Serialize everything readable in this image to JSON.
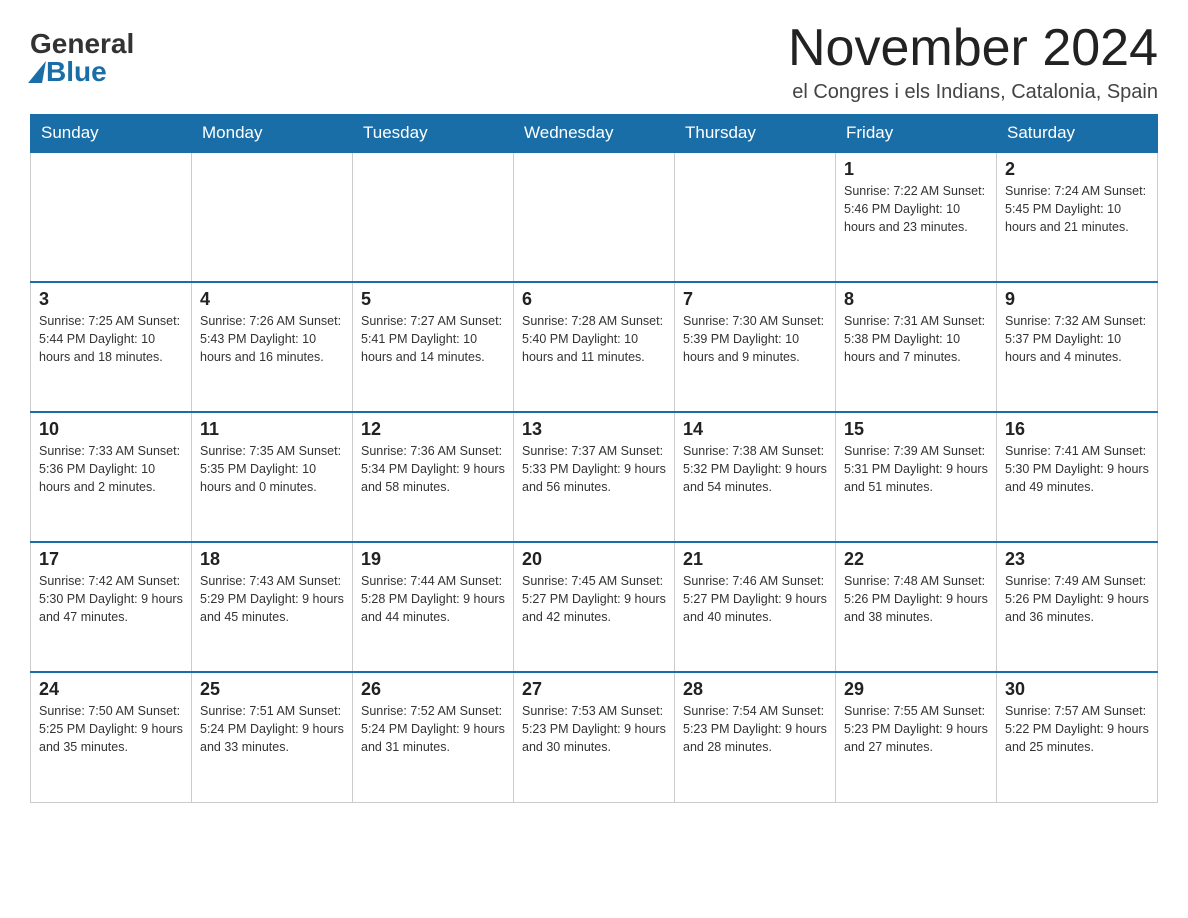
{
  "header": {
    "logo_general": "General",
    "logo_blue": "Blue",
    "month_title": "November 2024",
    "subtitle": "el Congres i els Indians, Catalonia, Spain"
  },
  "days_of_week": [
    "Sunday",
    "Monday",
    "Tuesday",
    "Wednesday",
    "Thursday",
    "Friday",
    "Saturday"
  ],
  "weeks": [
    [
      {
        "day": "",
        "info": ""
      },
      {
        "day": "",
        "info": ""
      },
      {
        "day": "",
        "info": ""
      },
      {
        "day": "",
        "info": ""
      },
      {
        "day": "",
        "info": ""
      },
      {
        "day": "1",
        "info": "Sunrise: 7:22 AM\nSunset: 5:46 PM\nDaylight: 10 hours and 23 minutes."
      },
      {
        "day": "2",
        "info": "Sunrise: 7:24 AM\nSunset: 5:45 PM\nDaylight: 10 hours and 21 minutes."
      }
    ],
    [
      {
        "day": "3",
        "info": "Sunrise: 7:25 AM\nSunset: 5:44 PM\nDaylight: 10 hours and 18 minutes."
      },
      {
        "day": "4",
        "info": "Sunrise: 7:26 AM\nSunset: 5:43 PM\nDaylight: 10 hours and 16 minutes."
      },
      {
        "day": "5",
        "info": "Sunrise: 7:27 AM\nSunset: 5:41 PM\nDaylight: 10 hours and 14 minutes."
      },
      {
        "day": "6",
        "info": "Sunrise: 7:28 AM\nSunset: 5:40 PM\nDaylight: 10 hours and 11 minutes."
      },
      {
        "day": "7",
        "info": "Sunrise: 7:30 AM\nSunset: 5:39 PM\nDaylight: 10 hours and 9 minutes."
      },
      {
        "day": "8",
        "info": "Sunrise: 7:31 AM\nSunset: 5:38 PM\nDaylight: 10 hours and 7 minutes."
      },
      {
        "day": "9",
        "info": "Sunrise: 7:32 AM\nSunset: 5:37 PM\nDaylight: 10 hours and 4 minutes."
      }
    ],
    [
      {
        "day": "10",
        "info": "Sunrise: 7:33 AM\nSunset: 5:36 PM\nDaylight: 10 hours and 2 minutes."
      },
      {
        "day": "11",
        "info": "Sunrise: 7:35 AM\nSunset: 5:35 PM\nDaylight: 10 hours and 0 minutes."
      },
      {
        "day": "12",
        "info": "Sunrise: 7:36 AM\nSunset: 5:34 PM\nDaylight: 9 hours and 58 minutes."
      },
      {
        "day": "13",
        "info": "Sunrise: 7:37 AM\nSunset: 5:33 PM\nDaylight: 9 hours and 56 minutes."
      },
      {
        "day": "14",
        "info": "Sunrise: 7:38 AM\nSunset: 5:32 PM\nDaylight: 9 hours and 54 minutes."
      },
      {
        "day": "15",
        "info": "Sunrise: 7:39 AM\nSunset: 5:31 PM\nDaylight: 9 hours and 51 minutes."
      },
      {
        "day": "16",
        "info": "Sunrise: 7:41 AM\nSunset: 5:30 PM\nDaylight: 9 hours and 49 minutes."
      }
    ],
    [
      {
        "day": "17",
        "info": "Sunrise: 7:42 AM\nSunset: 5:30 PM\nDaylight: 9 hours and 47 minutes."
      },
      {
        "day": "18",
        "info": "Sunrise: 7:43 AM\nSunset: 5:29 PM\nDaylight: 9 hours and 45 minutes."
      },
      {
        "day": "19",
        "info": "Sunrise: 7:44 AM\nSunset: 5:28 PM\nDaylight: 9 hours and 44 minutes."
      },
      {
        "day": "20",
        "info": "Sunrise: 7:45 AM\nSunset: 5:27 PM\nDaylight: 9 hours and 42 minutes."
      },
      {
        "day": "21",
        "info": "Sunrise: 7:46 AM\nSunset: 5:27 PM\nDaylight: 9 hours and 40 minutes."
      },
      {
        "day": "22",
        "info": "Sunrise: 7:48 AM\nSunset: 5:26 PM\nDaylight: 9 hours and 38 minutes."
      },
      {
        "day": "23",
        "info": "Sunrise: 7:49 AM\nSunset: 5:26 PM\nDaylight: 9 hours and 36 minutes."
      }
    ],
    [
      {
        "day": "24",
        "info": "Sunrise: 7:50 AM\nSunset: 5:25 PM\nDaylight: 9 hours and 35 minutes."
      },
      {
        "day": "25",
        "info": "Sunrise: 7:51 AM\nSunset: 5:24 PM\nDaylight: 9 hours and 33 minutes."
      },
      {
        "day": "26",
        "info": "Sunrise: 7:52 AM\nSunset: 5:24 PM\nDaylight: 9 hours and 31 minutes."
      },
      {
        "day": "27",
        "info": "Sunrise: 7:53 AM\nSunset: 5:23 PM\nDaylight: 9 hours and 30 minutes."
      },
      {
        "day": "28",
        "info": "Sunrise: 7:54 AM\nSunset: 5:23 PM\nDaylight: 9 hours and 28 minutes."
      },
      {
        "day": "29",
        "info": "Sunrise: 7:55 AM\nSunset: 5:23 PM\nDaylight: 9 hours and 27 minutes."
      },
      {
        "day": "30",
        "info": "Sunrise: 7:57 AM\nSunset: 5:22 PM\nDaylight: 9 hours and 25 minutes."
      }
    ]
  ]
}
